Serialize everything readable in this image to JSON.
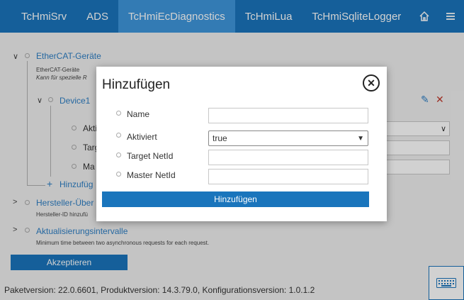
{
  "nav": {
    "tabs": [
      {
        "label": "TcHmiSrv"
      },
      {
        "label": "ADS"
      },
      {
        "label": "TcHmiEcDiagnostics",
        "active": true
      },
      {
        "label": "TcHmiLua"
      },
      {
        "label": "TcHmiSqliteLogger"
      }
    ],
    "home_icon": "home-icon",
    "menu_icon": "hamburger-menu-icon"
  },
  "tree": {
    "ethercat": {
      "title": "EtherCAT-Geräte",
      "desc1": "EtherCAT-Geräte",
      "desc2": "Kann für spezielle R"
    },
    "device": {
      "title": "Device1",
      "children": [
        "Akti",
        "Targ",
        "Ma"
      ]
    },
    "add_link": "Hinzufüg",
    "manufacturer": {
      "title": "Hersteller-Über",
      "desc": "Hersteller-ID hinzufü"
    },
    "update": {
      "title": "Aktualisierungsintervalle",
      "desc": "Minimum time between two asynchronous requests for each request."
    }
  },
  "accept_button": "Akzeptieren",
  "footer": {
    "text": "Paketversion: 22.0.6601, Produktversion: 14.3.79.0, Konfigurationsversion: 1.0.1.2"
  },
  "modal": {
    "title": "Hinzufügen",
    "fields": [
      {
        "label": "Name",
        "value": ""
      },
      {
        "label": "Aktiviert",
        "value": "true"
      },
      {
        "label": "Target NetId",
        "value": ""
      },
      {
        "label": "Master NetId",
        "value": ""
      }
    ],
    "submit": "Hinzufügen"
  },
  "colors": {
    "accent": "#1a75bc",
    "active_tab": "#3f97dc",
    "delete": "#c0392b"
  }
}
